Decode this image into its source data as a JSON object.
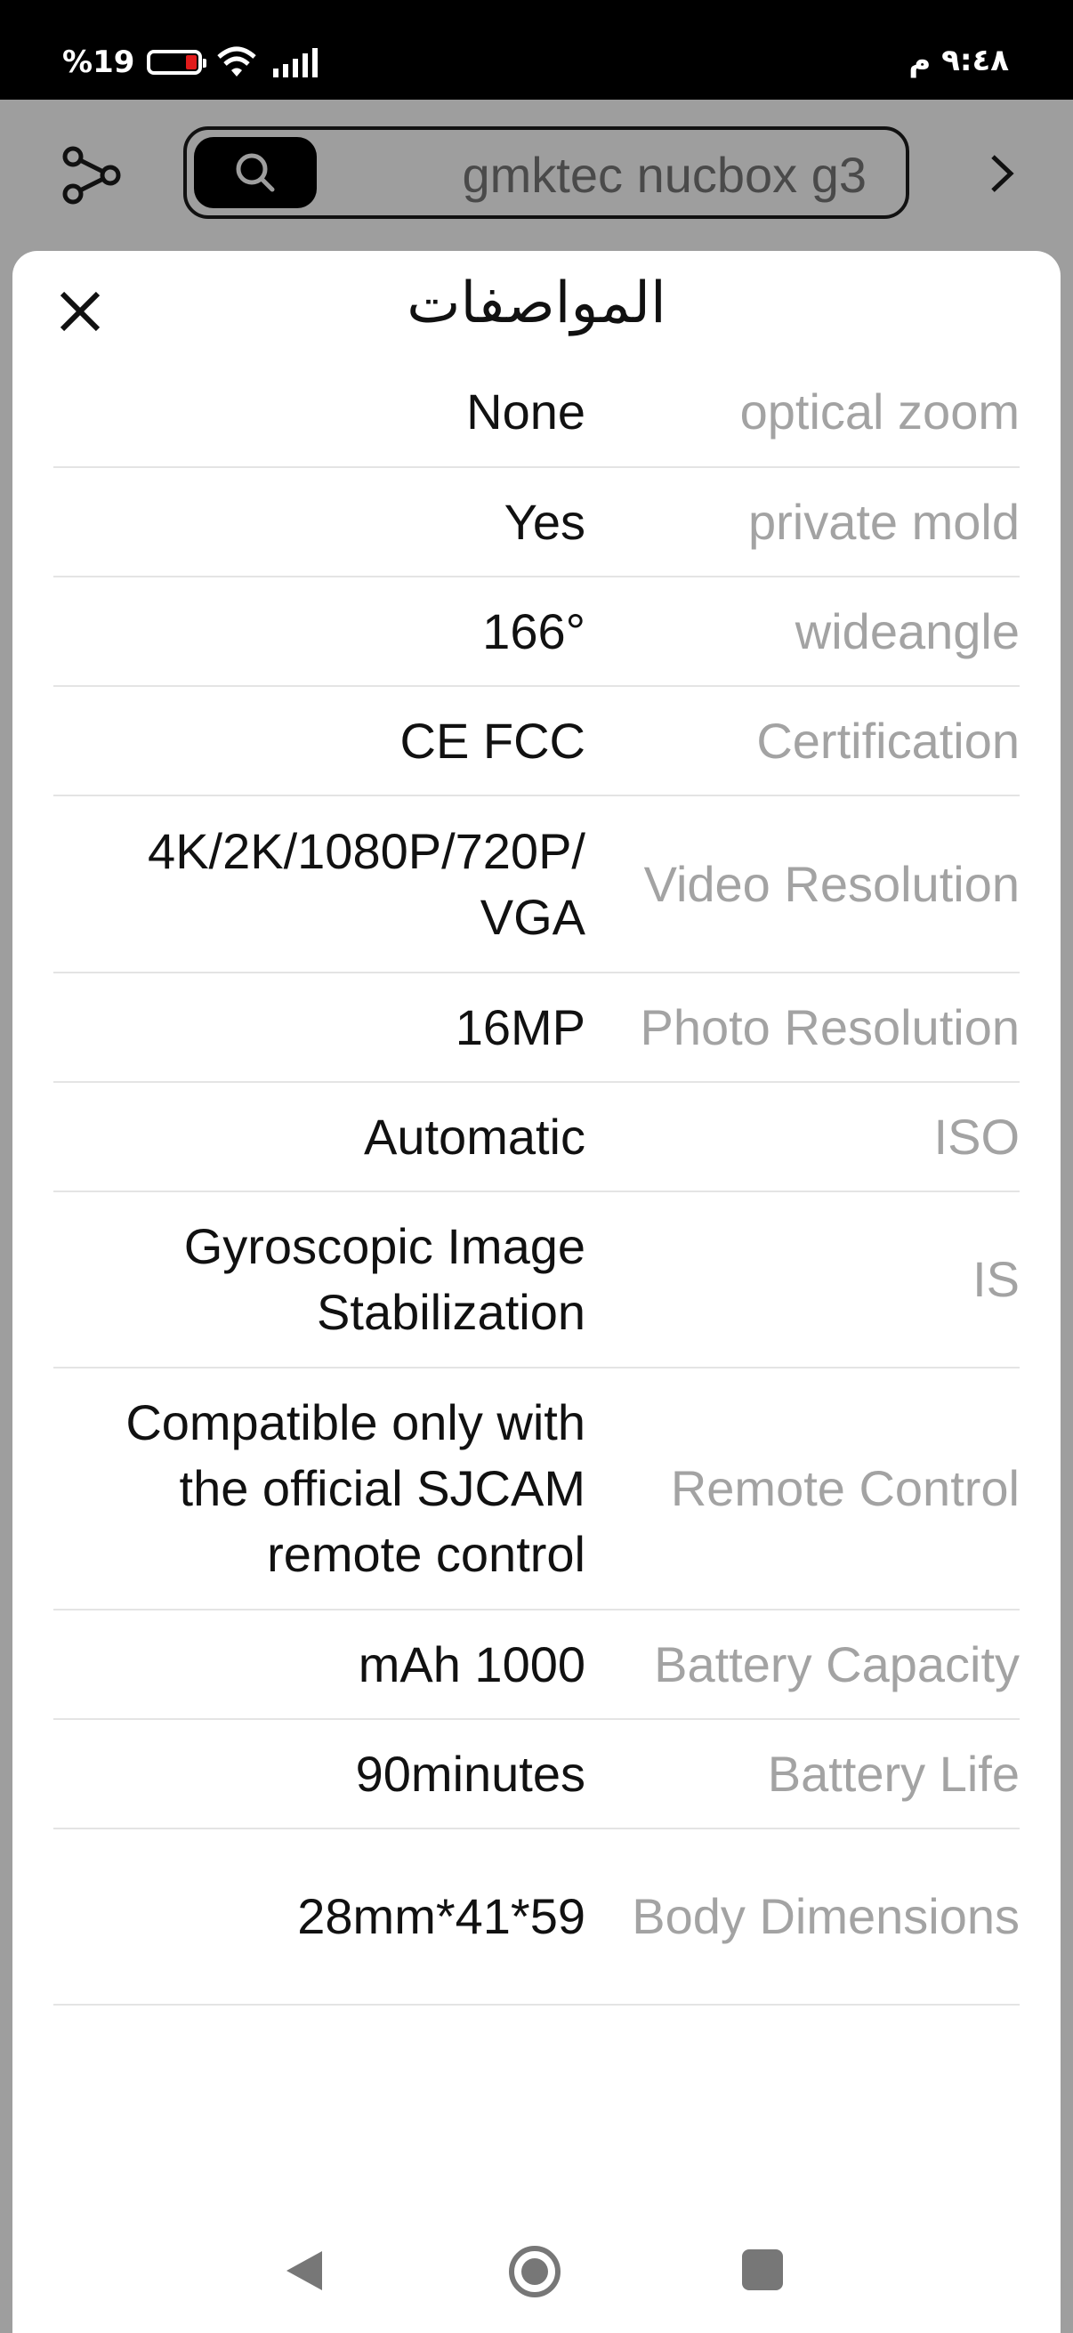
{
  "status_bar": {
    "battery_text": "%19",
    "time": "٩:٤٨ م"
  },
  "search": {
    "query": "gmktec nucbox g3"
  },
  "sheet": {
    "title": "المواصفات"
  },
  "specs": [
    {
      "label": "optical zoom",
      "value": "None"
    },
    {
      "label": "private mold",
      "value": "Yes"
    },
    {
      "label": "wideangle",
      "value": "166°"
    },
    {
      "label": "Certification",
      "value": "CE FCC"
    },
    {
      "label": "Video Resolution",
      "value": "4K/2K/1080P/720P/ VGA"
    },
    {
      "label": "Photo Resolution",
      "value": "16MP"
    },
    {
      "label": "ISO",
      "value": "Automatic"
    },
    {
      "label": "IS",
      "value": "Gyroscopic Image Stabilization"
    },
    {
      "label": "Remote Control",
      "value": "Compatible only with the official SJCAM remote control"
    },
    {
      "label": "Battery Capacity",
      "value": "mAh 1000"
    },
    {
      "label": "Battery Life",
      "value": "90minutes"
    },
    {
      "label": "Body Dimensions",
      "value": "28mm*41*59"
    }
  ]
}
